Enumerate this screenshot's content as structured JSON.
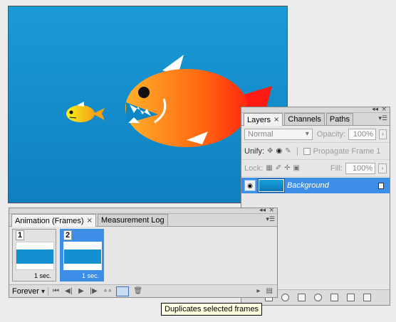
{
  "layers_panel": {
    "tabs": [
      {
        "label": "Layers",
        "close": "×"
      },
      {
        "label": "Channels"
      },
      {
        "label": "Paths"
      }
    ],
    "blend_mode": "Normal",
    "opacity_label": "Opacity:",
    "opacity_value": "100%",
    "unify_label": "Unify:",
    "propagate_label": "Propagate Frame 1",
    "lock_label": "Lock:",
    "fill_label": "Fill:",
    "fill_value": "100%",
    "layer_name": "Background"
  },
  "animation_panel": {
    "tabs": [
      {
        "label": "Animation (Frames)",
        "close": "×"
      },
      {
        "label": "Measurement Log"
      }
    ],
    "frames": [
      {
        "number": "1",
        "delay": "1 sec.",
        "selected": false
      },
      {
        "number": "2",
        "delay": "1 sec.",
        "selected": true
      }
    ],
    "loop_option": "Forever"
  },
  "tooltip": "Duplicates selected frames",
  "colors": {
    "sky_top": "#1a9ad6",
    "fish_big_orange": "#ff6a12",
    "fish_small_yellow": "#f7e51c",
    "selection_blue": "#3d8ee6"
  }
}
